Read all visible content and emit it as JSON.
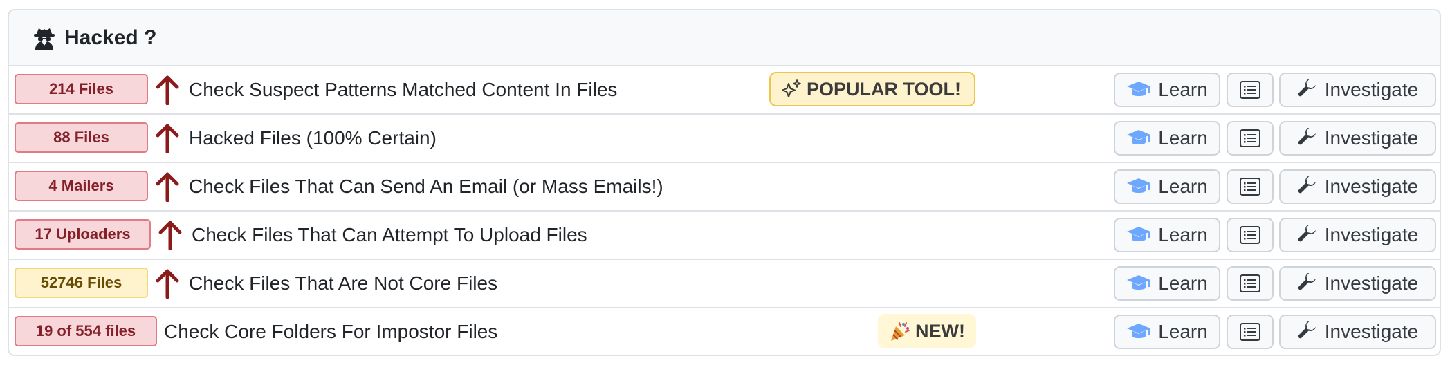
{
  "header": {
    "title": "Hacked ?",
    "icon": "spy-icon"
  },
  "buttons": {
    "learn_label": "Learn",
    "investigate_label": "Investigate"
  },
  "colors": {
    "danger_badge_bg": "#f8d7da",
    "danger_badge_border": "#e17b84",
    "danger_text": "#842029",
    "warning_badge_bg": "#fff3cd",
    "warning_text": "#664d03",
    "arrow": "#8b1a1a",
    "learn_icon": "#6ea8fe"
  },
  "rows": [
    {
      "badge": "214 Files",
      "badge_style": "danger",
      "trend_icon": "arrow-up-icon",
      "title": "Check Suspect Patterns Matched Content In Files",
      "tag": "POPULAR TOOL!",
      "tag_icon": "sparkles-icon"
    },
    {
      "badge": "88 Files",
      "badge_style": "danger",
      "trend_icon": "arrow-up-icon",
      "title": "Hacked Files (100% Certain)"
    },
    {
      "badge": "4 Mailers",
      "badge_style": "danger",
      "trend_icon": "arrow-up-icon",
      "title": "Check Files That Can Send An Email (or Mass Emails!)"
    },
    {
      "badge": "17 Uploaders",
      "badge_style": "danger",
      "trend_icon": "arrow-up-icon",
      "title": "Check Files That Can Attempt To Upload Files"
    },
    {
      "badge": "52746 Files",
      "badge_style": "warning",
      "trend_icon": "arrow-up-icon",
      "title": "Check Files That Are Not Core Files"
    },
    {
      "badge": "19 of 554 files",
      "badge_style": "danger",
      "title": "Check Core Folders For Impostor Files",
      "tag": "NEW!",
      "tag_icon": "party-popper-icon"
    }
  ]
}
